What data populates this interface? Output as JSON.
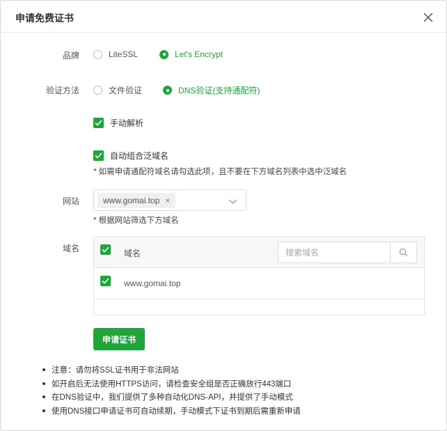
{
  "dialog": {
    "title": "申请免费证书"
  },
  "brand": {
    "label": "品牌",
    "options": [
      {
        "label": "LiteSSL",
        "checked": false
      },
      {
        "label": "Let's Encrypt",
        "checked": true
      }
    ]
  },
  "verify": {
    "label": "验证方法",
    "options": [
      {
        "label": "文件验证",
        "checked": false
      },
      {
        "label": "DNS验证(支持通配符)",
        "checked": true
      }
    ]
  },
  "manual_resolve": {
    "label": "手动解析",
    "checked": true
  },
  "auto_wildcard": {
    "label": "自动组合泛域名",
    "checked": true,
    "hint": "* 如需申请通配符域名请勾选此项，且不要在下方域名列表中选中泛域名"
  },
  "site": {
    "label": "网站",
    "selected_tag": "www.gomai.top",
    "tag_close": "×",
    "hint": "* 根据网站筛选下方域名"
  },
  "domains": {
    "label": "域名",
    "header_label": "域名",
    "search_placeholder": "搜索域名",
    "rows": [
      {
        "domain": "www.gomai.top",
        "checked": true
      }
    ]
  },
  "apply_button": "申请证书",
  "notes": [
    "注意：请勿将SSL证书用于非法网站",
    "如开启后无法使用HTTPS访问，请检查安全组是否正确放行443端口",
    "在DNS验证中，我们提供了多种自动化DNS-API，并提供了手动模式",
    "使用DNS接口申请证书可自动续期，手动模式下证书到期后需重新申请"
  ],
  "colors": {
    "accent": "#20a53a"
  },
  "icons": [
    "close-icon",
    "chevron-down-icon",
    "search-icon",
    "check-icon"
  ]
}
